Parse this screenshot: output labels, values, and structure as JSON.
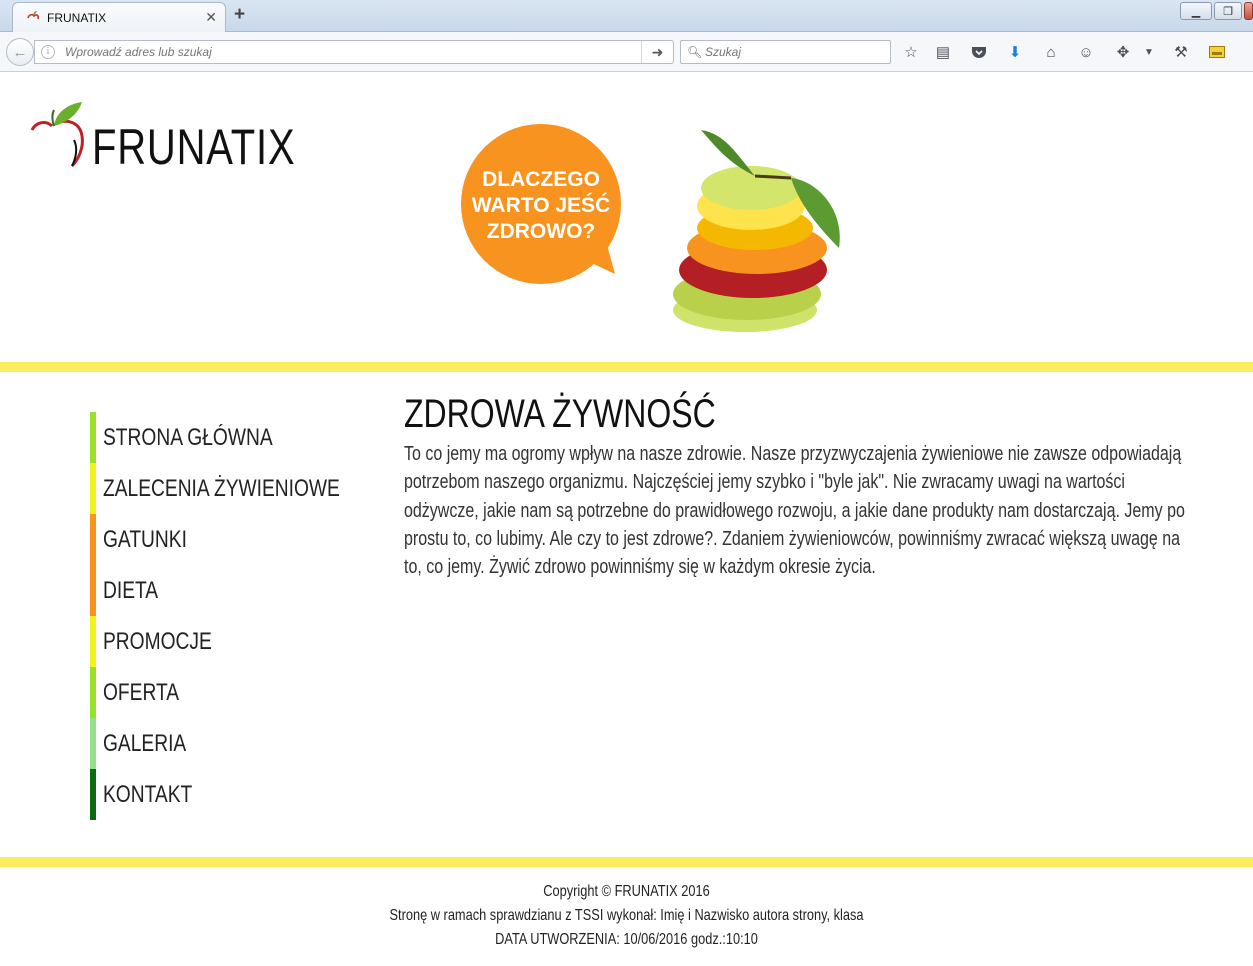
{
  "browser": {
    "tab_title": "FRUNATIX",
    "new_tab_symbol": "+",
    "url_placeholder": "Wprowadź adres lub szukaj",
    "search_placeholder": "Szukaj",
    "toolbar_icons": [
      "bookmark-star-icon",
      "reading-list-icon",
      "pocket-icon",
      "downloads-icon",
      "home-icon",
      "chat-icon",
      "extension-icon",
      "dropdown-icon",
      "tool-icon",
      "sidebar-icon"
    ]
  },
  "site": {
    "logo_text": "FRUNATIX",
    "banner_text": [
      "DLACZEGO",
      "WARTO JEŚĆ",
      "ZDROWO?"
    ],
    "colors": {
      "stripe": "#fbee5e",
      "banner_bubble": "#f7931e"
    }
  },
  "nav": {
    "items": [
      {
        "label": "STRONA GŁÓWNA",
        "color": "#99e22b"
      },
      {
        "label": "ZALECENIA ŻYWIENIOWE",
        "color": "#f2f21f"
      },
      {
        "label": "GATUNKI",
        "color": "#f7931e"
      },
      {
        "label": "DIETA",
        "color": "#f7931e"
      },
      {
        "label": "PROMOCJE",
        "color": "#f2f21f"
      },
      {
        "label": "OFERTA",
        "color": "#99e22b"
      },
      {
        "label": "GALERIA",
        "color": "#93e08f"
      },
      {
        "label": "KONTAKT",
        "color": "#0b6b13"
      }
    ]
  },
  "main": {
    "heading": "ZDROWA ŻYWNOŚĆ",
    "body": "To co jemy ma ogromy wpływ na nasze zdrowie. Nasze przyzwyczajenia żywieniowe nie zawsze odpowiadają potrzebom naszego organizmu. Najczęściej jemy szybko i \"byle jak\". Nie zwracamy uwagi na wartości odżywcze, jakie nam są potrzebne do prawidłowego rozwoju, a jakie dane produkty nam dostarczają. Jemy po prostu to, co lubimy. Ale czy to jest zdrowe?. Zdaniem żywieniowców, powinniśmy zwracać większą uwagę na to, co jemy. Żywić zdrowo powinniśmy się w każdym okresie życia."
  },
  "footer": {
    "copyright": "Copyright © FRUNATIX 2016",
    "author": "Stronę w ramach sprawdzianu z TSSI wykonał: Imię i Nazwisko autora strony, klasa",
    "created": "DATA UTWORZENIA: 10/06/2016 godz.:10:10"
  }
}
